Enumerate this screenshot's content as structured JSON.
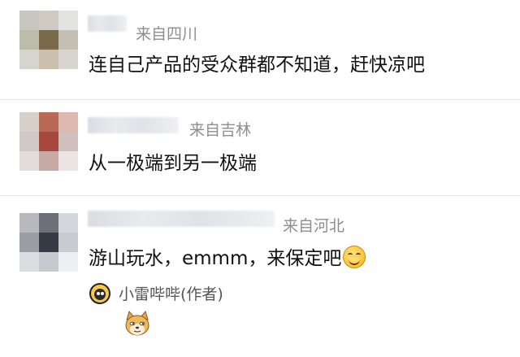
{
  "comments": [
    {
      "origin": "来自四川",
      "text": "连自己产品的受众群都不知道，赶快凉吧"
    },
    {
      "origin": "来自吉林",
      "text": "从一极端到另一极端"
    },
    {
      "origin": "来自河北",
      "text": "游山玩水，emmm，来保定吧",
      "emoji": "smiling-face-emoji"
    }
  ],
  "reply": {
    "author": "小雷哔哔(作者)",
    "sticker": "doge-emoji"
  },
  "colors": {
    "text": "#111111",
    "meta": "#8e8e8e",
    "divider": "#e6e6e6"
  }
}
